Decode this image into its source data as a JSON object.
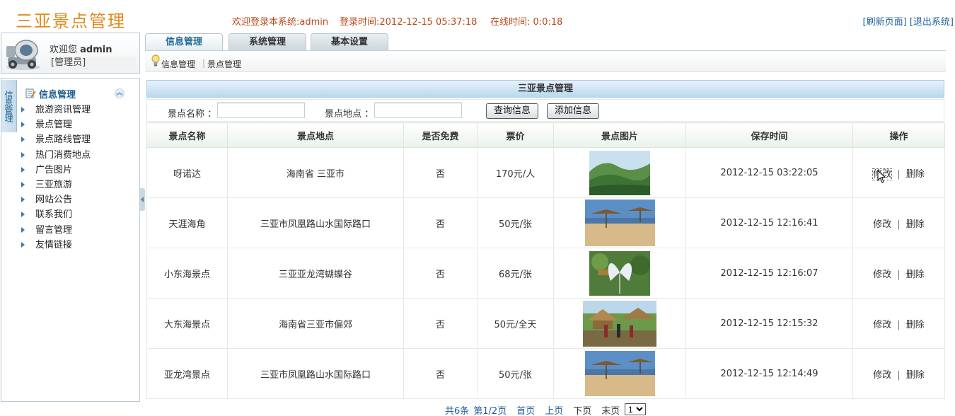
{
  "header": {
    "app_title": "三亚景点管理",
    "welcome_msg": "欢迎登录本系统:admin",
    "login_time": "登录时间:2012-12-15 05:37:18",
    "online_time": "在线时间: 0:0:18",
    "refresh_link": "[刷新页面]",
    "logout_link": "[退出系统]"
  },
  "user": {
    "welcome_prefix": "欢迎您 ",
    "username": "admin",
    "role": "[管理员]"
  },
  "tabs": [
    {
      "label": "信息管理",
      "active": true
    },
    {
      "label": "系统管理",
      "active": false
    },
    {
      "label": "基本设置",
      "active": false
    }
  ],
  "breadcrumb": [
    "信息管理",
    "景点管理"
  ],
  "sidebar": {
    "side_tab": "信息管理",
    "heading": "信息管理",
    "items": [
      {
        "label": "旅游资讯管理"
      },
      {
        "label": "景点管理"
      },
      {
        "label": "景点路线管理"
      },
      {
        "label": "热门消费地点"
      },
      {
        "label": "广告图片"
      },
      {
        "label": "三亚旅游"
      },
      {
        "label": "网站公告"
      },
      {
        "label": "联系我们"
      },
      {
        "label": "留言管理"
      },
      {
        "label": "友情链接"
      }
    ]
  },
  "panel": {
    "title": "三亚景点管理",
    "search": {
      "name_label": "景点名称 ：",
      "name_value": "",
      "location_label": "景点地点 ：",
      "location_value": "",
      "query_button": "查询信息",
      "add_button": "添加信息"
    }
  },
  "table": {
    "columns": [
      "景点名称",
      "景点地点",
      "是否免费",
      "票价",
      "景点图片",
      "保存时间",
      "操作"
    ],
    "rows": [
      {
        "name": "呀诺达",
        "location": "海南省 三亚市",
        "free": "否",
        "price": "170元/人",
        "image": "forest-photo-icon",
        "saved": "2012-12-15 03:22:05",
        "edit": "修改",
        "delete": "删除"
      },
      {
        "name": "天涯海角",
        "location": "三亚市凤凰路山水国际路口",
        "free": "否",
        "price": "50元/张",
        "image": "beach-photo-icon",
        "saved": "2012-12-15 12:16:41",
        "edit": "修改",
        "delete": "删除"
      },
      {
        "name": "小东海景点",
        "location": "三亚亚龙湾蝴蝶谷",
        "free": "否",
        "price": "68元/张",
        "image": "butterfly-photo-icon",
        "saved": "2012-12-15 12:16:07",
        "edit": "修改",
        "delete": "删除"
      },
      {
        "name": "大东海景点",
        "location": "海南省三亚市偏郊",
        "free": "否",
        "price": "50元/全天",
        "image": "village-photo-icon",
        "saved": "2012-12-15 12:15:32",
        "edit": "修改",
        "delete": "删除"
      },
      {
        "name": "亚龙湾景点",
        "location": "三亚市凤凰路山水国际路口",
        "free": "否",
        "price": "50元/张",
        "image": "beach-photo-icon",
        "saved": "2012-12-15 12:14:49",
        "edit": "修改",
        "delete": "删除"
      }
    ]
  },
  "pagination": {
    "total": "共6条",
    "page_info": "第1/2页",
    "first": "首页",
    "prev": "上页",
    "next": "下页",
    "last": "末页",
    "selected_page": "1"
  },
  "colors": {
    "title_orange": "#e08a1c",
    "header_text": "#b54a1a",
    "link_blue": "#1f5f9c",
    "panel_header_blue": "#b9d8ef"
  }
}
